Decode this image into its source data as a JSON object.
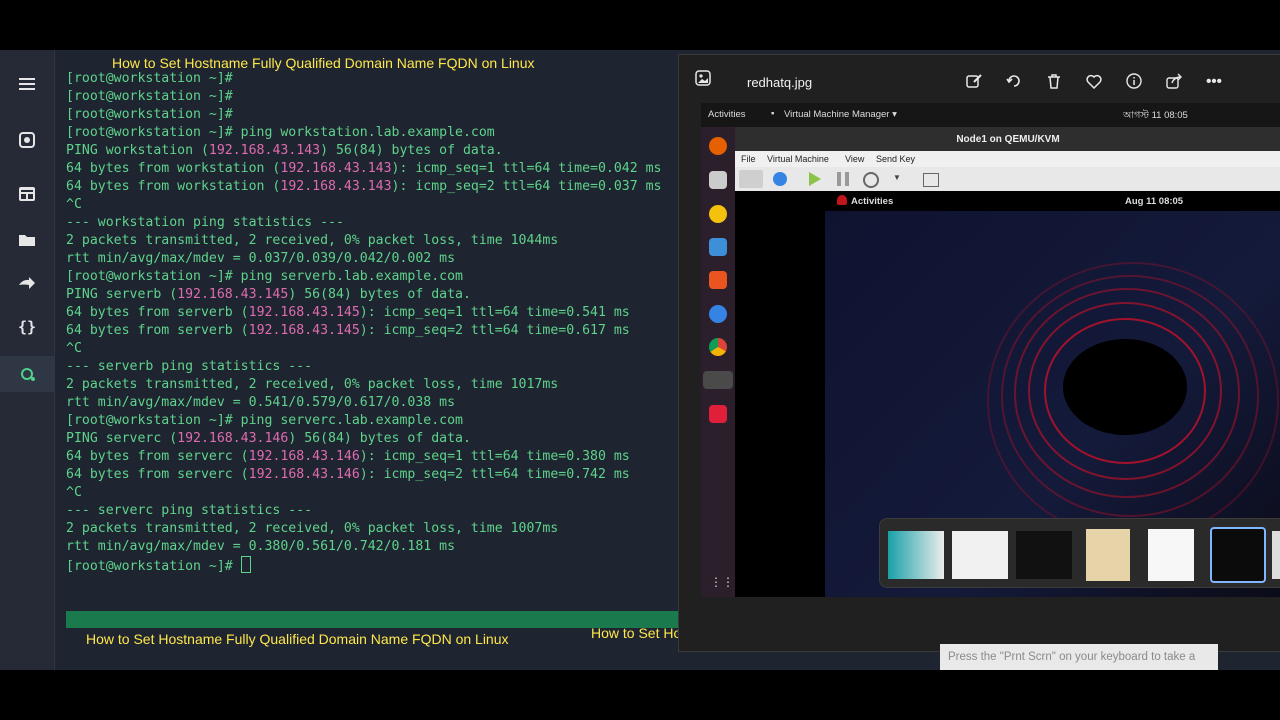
{
  "overlay": {
    "title_top": "How to Set Hostname Fully Qualified Domain Name FQDN on Linux",
    "title_bottom_left": "How to Set Hostname Fully Qualified Domain Name FQDN on Linux",
    "title_bottom_right": "How to Set Hostname Fully Qualified Domain Name FQDN on Linux"
  },
  "sidebar": {
    "icons": [
      "menu-icon",
      "settings-icon",
      "dashboard-icon",
      "folder-icon",
      "forward-icon",
      "braces-icon",
      "git-icon"
    ]
  },
  "terminal": {
    "lines": [
      {
        "t": "[root@workstation ~]#"
      },
      {
        "t": "[root@workstation ~]#"
      },
      {
        "t": "[root@workstation ~]#"
      },
      {
        "t": "[root@workstation ~]# ping workstation.lab.example.com"
      },
      {
        "pre": "PING workstation (",
        "ip": "192.168.43.143",
        "post": ") 56(84) bytes of data."
      },
      {
        "pre": "64 bytes from workstation (",
        "ip": "192.168.43.143",
        "post": "): icmp_seq=1 ttl=64 time=0.042 ms"
      },
      {
        "pre": "64 bytes from workstation (",
        "ip": "192.168.43.143",
        "post": "): icmp_seq=2 ttl=64 time=0.037 ms"
      },
      {
        "t": "^C"
      },
      {
        "t": "--- workstation ping statistics ---"
      },
      {
        "t": "2 packets transmitted, 2 received, 0% packet loss, time 1044ms"
      },
      {
        "t": "rtt min/avg/max/mdev = 0.037/0.039/0.042/0.002 ms"
      },
      {
        "t": "[root@workstation ~]# ping serverb.lab.example.com"
      },
      {
        "pre": "PING serverb (",
        "ip": "192.168.43.145",
        "post": ") 56(84) bytes of data."
      },
      {
        "pre": "64 bytes from serverb (",
        "ip": "192.168.43.145",
        "post": "): icmp_seq=1 ttl=64 time=0.541 ms"
      },
      {
        "pre": "64 bytes from serverb (",
        "ip": "192.168.43.145",
        "post": "): icmp_seq=2 ttl=64 time=0.617 ms"
      },
      {
        "t": "^C"
      },
      {
        "t": "--- serverb ping statistics ---"
      },
      {
        "t": "2 packets transmitted, 2 received, 0% packet loss, time 1017ms"
      },
      {
        "t": "rtt min/avg/max/mdev = 0.541/0.579/0.617/0.038 ms"
      },
      {
        "t": "[root@workstation ~]# ping serverc.lab.example.com"
      },
      {
        "pre": "PING serverc (",
        "ip": "192.168.43.146",
        "post": ") 56(84) bytes of data."
      },
      {
        "pre": "64 bytes from serverc (",
        "ip": "192.168.43.146",
        "post": "): icmp_seq=1 ttl=64 time=0.380 ms"
      },
      {
        "pre": "64 bytes from serverc (",
        "ip": "192.168.43.146",
        "post": "): icmp_seq=2 ttl=64 time=0.742 ms"
      },
      {
        "t": "^C"
      },
      {
        "t": "--- serverc ping statistics ---"
      },
      {
        "t": "2 packets transmitted, 2 received, 0% packet loss, time 1007ms"
      },
      {
        "t": "rtt min/avg/max/mdev = 0.380/0.561/0.742/0.181 ms"
      },
      {
        "t": "[root@workstation ~]# ",
        "cursor": true
      }
    ]
  },
  "viewer": {
    "filename": "redhatq.jpg",
    "actions": [
      "edit-icon",
      "rotate-icon",
      "delete-icon",
      "favorite-icon",
      "info-icon",
      "share-icon",
      "more-icon"
    ],
    "hint": "Press the \"Prnt Scrn\" on your keyboard to take a"
  },
  "screenshot": {
    "activities": "Activities",
    "app_menu": "Virtual Machine Manager ▾",
    "clock": "আগস্ট 11  08:05",
    "vm_title": "Node1 on QEMU/KVM",
    "menu": [
      "File",
      "Virtual Machine",
      "View",
      "Send Key"
    ],
    "guest_activities": "Activities",
    "guest_clock": "Aug 11  08:05"
  }
}
